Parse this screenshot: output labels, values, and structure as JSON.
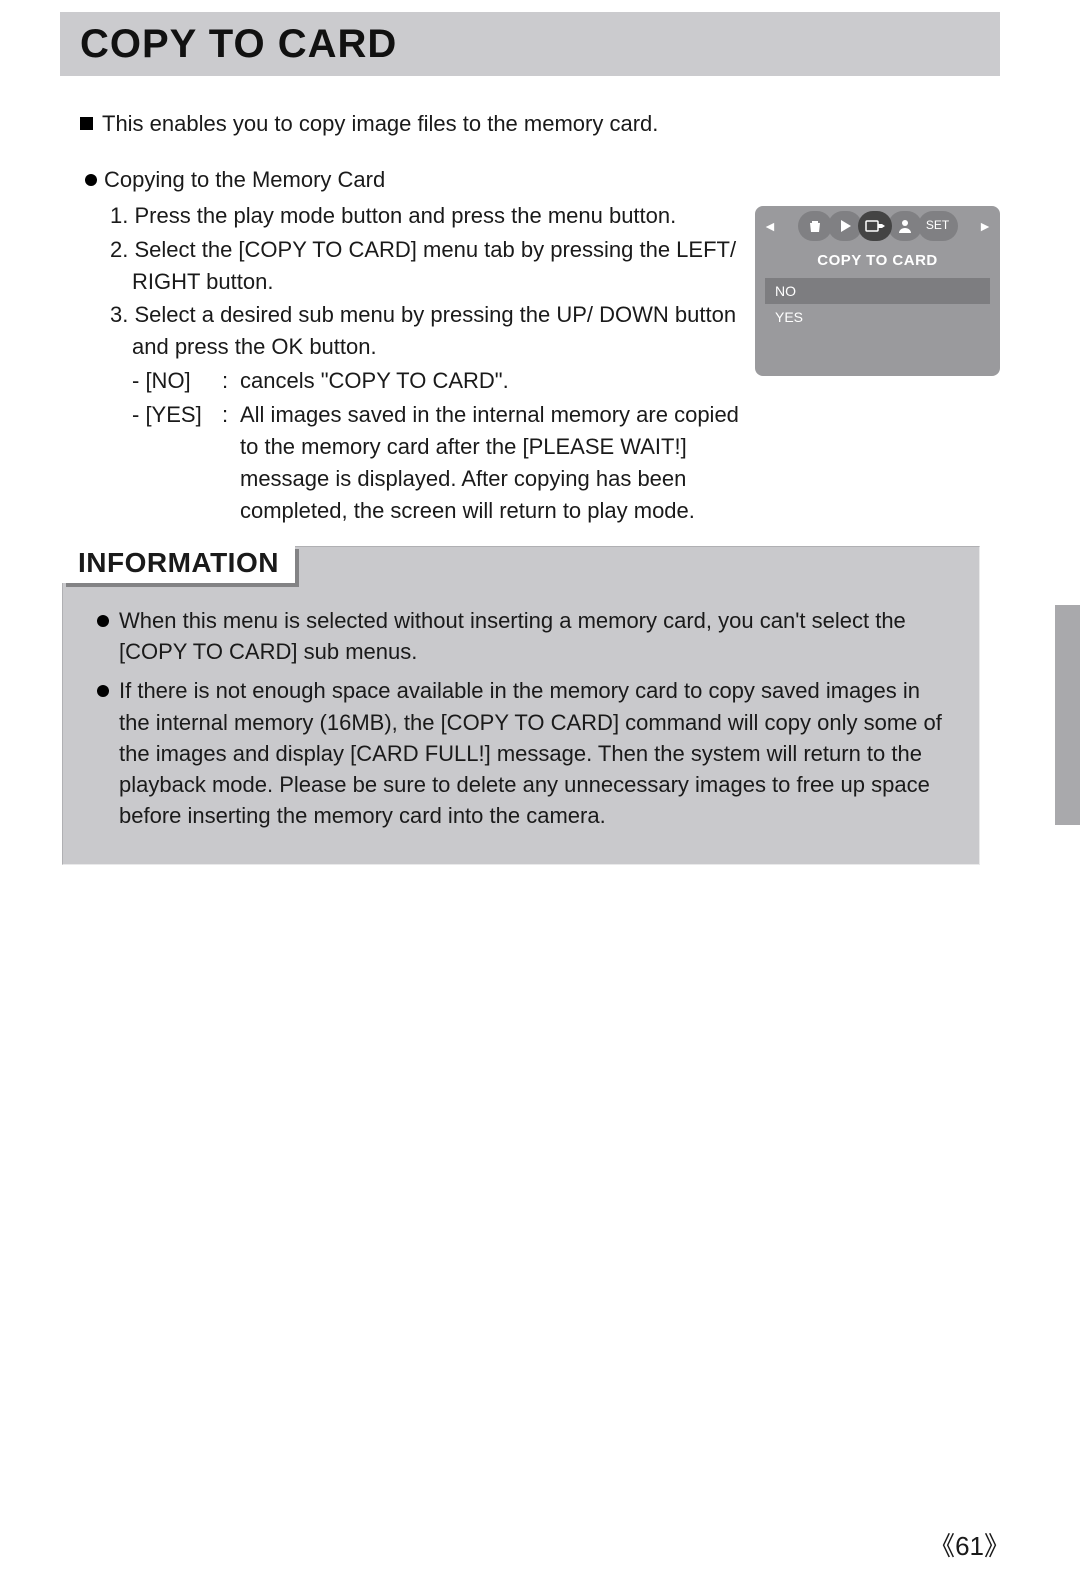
{
  "title": "COPY TO CARD",
  "lead": "This enables you to copy image files to the memory card.",
  "section_heading": "Copying to the Memory Card",
  "steps": {
    "s1": "1. Press the play mode button and press the menu button.",
    "s2": "2. Select the [COPY TO CARD] menu tab by pressing the LEFT/ RIGHT button.",
    "s3": "3. Select a desired sub menu by pressing the UP/ DOWN button and press the OK button."
  },
  "options": {
    "no": {
      "label": "- [NO]",
      "desc": "cancels \"COPY TO CARD\"."
    },
    "yes": {
      "label": "- [YES]",
      "desc": "All images saved in the internal memory are copied to the memory card after the [PLEASE WAIT!] message is displayed. After copying has been completed, the screen will return to play mode."
    }
  },
  "lcd": {
    "title": "COPY TO CARD",
    "item_no": "NO",
    "item_yes": "YES",
    "set": "SET"
  },
  "info": {
    "heading": "INFORMATION",
    "b1": "When this menu is selected without inserting a memory card, you can't select the [COPY TO CARD] sub menus.",
    "b2": "If there is not enough space available in the memory card to copy saved images in the internal memory (16MB), the [COPY TO CARD] command will copy only some of the images and display [CARD FULL!] message. Then the system will return to the playback mode. Please be sure to delete any unnecessary images to free up space before inserting the memory card into the camera."
  },
  "page": "61"
}
